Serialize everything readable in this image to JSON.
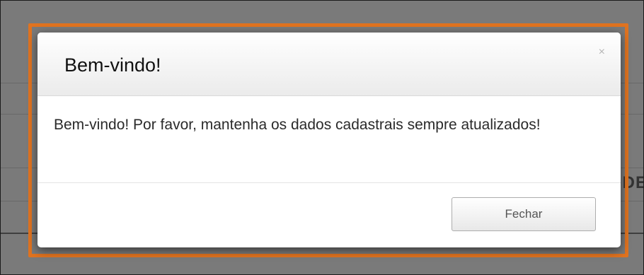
{
  "background": {
    "partial_text": "DE"
  },
  "modal": {
    "title": "Bem-vindo!",
    "close_icon": "×",
    "message": "Bem-vindo! Por favor, mantenha os dados cadastrais sempre atualizados!",
    "close_button_label": "Fechar"
  },
  "colors": {
    "highlight": "#e07320",
    "overlay": "#7a7a7a",
    "modal_bg": "#ffffff"
  }
}
